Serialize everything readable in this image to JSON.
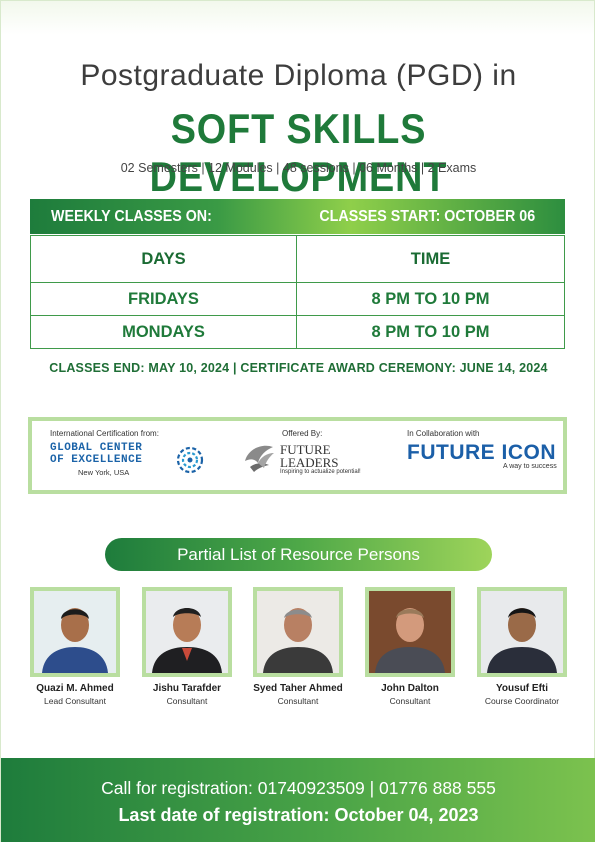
{
  "header": {
    "title_line1": "Postgraduate Diploma (PGD) in",
    "title_line2": "SOFT SKILLS DEVELOPMENT",
    "subtitle": "02 Semesters | 12 Modules | 48 sessions | 06 Months | 2 Exams"
  },
  "weekly_bar": {
    "left": "WEEKLY CLASSES ON:",
    "right": "CLASSES START: OCTOBER 06"
  },
  "schedule": {
    "headers": [
      "DAYS",
      "TIME"
    ],
    "rows": [
      [
        "FRIDAYS",
        "8 PM TO 10 PM"
      ],
      [
        "MONDAYS",
        "8 PM TO 10 PM"
      ]
    ]
  },
  "classes_end": "CLASSES END: MAY 10, 2024  |  CERTIFICATE AWARD CEREMONY: JUNE 14, 2024",
  "partners": {
    "certification": {
      "label": "International Certification from:",
      "name_line1": "GLOBAL CENTER",
      "name_line2": "OF EXCELLENCE",
      "city": "New York, USA"
    },
    "offered_by": {
      "label": "Offered By:",
      "name_line1": "FUTURE",
      "name_line2": "LEADERS",
      "tagline": "Inspiring to actualize potential!"
    },
    "collaboration": {
      "label": "In Collaboration with",
      "name": "FUTURE ICON",
      "tagline": "A way to success"
    }
  },
  "resource_persons": {
    "title": "Partial List of Resource Persons",
    "people": [
      {
        "name": "Quazi M. Ahmed",
        "role": "Lead Consultant"
      },
      {
        "name": "Jishu Tarafder",
        "role": "Consultant"
      },
      {
        "name": "Syed Taher Ahmed",
        "role": "Consultant"
      },
      {
        "name": "John Dalton",
        "role": "Consultant"
      },
      {
        "name": "Yousuf Efti",
        "role": "Course Coordinator"
      }
    ]
  },
  "footer": {
    "call_line": "Call for registration:  01740923509 | 01776 888 555",
    "deadline_line": "Last date of registration: October 04, 2023"
  },
  "colors": {
    "brand_green": "#1f7a3a",
    "light_green": "#b9dea0",
    "partner_blue": "#1b63a8"
  }
}
